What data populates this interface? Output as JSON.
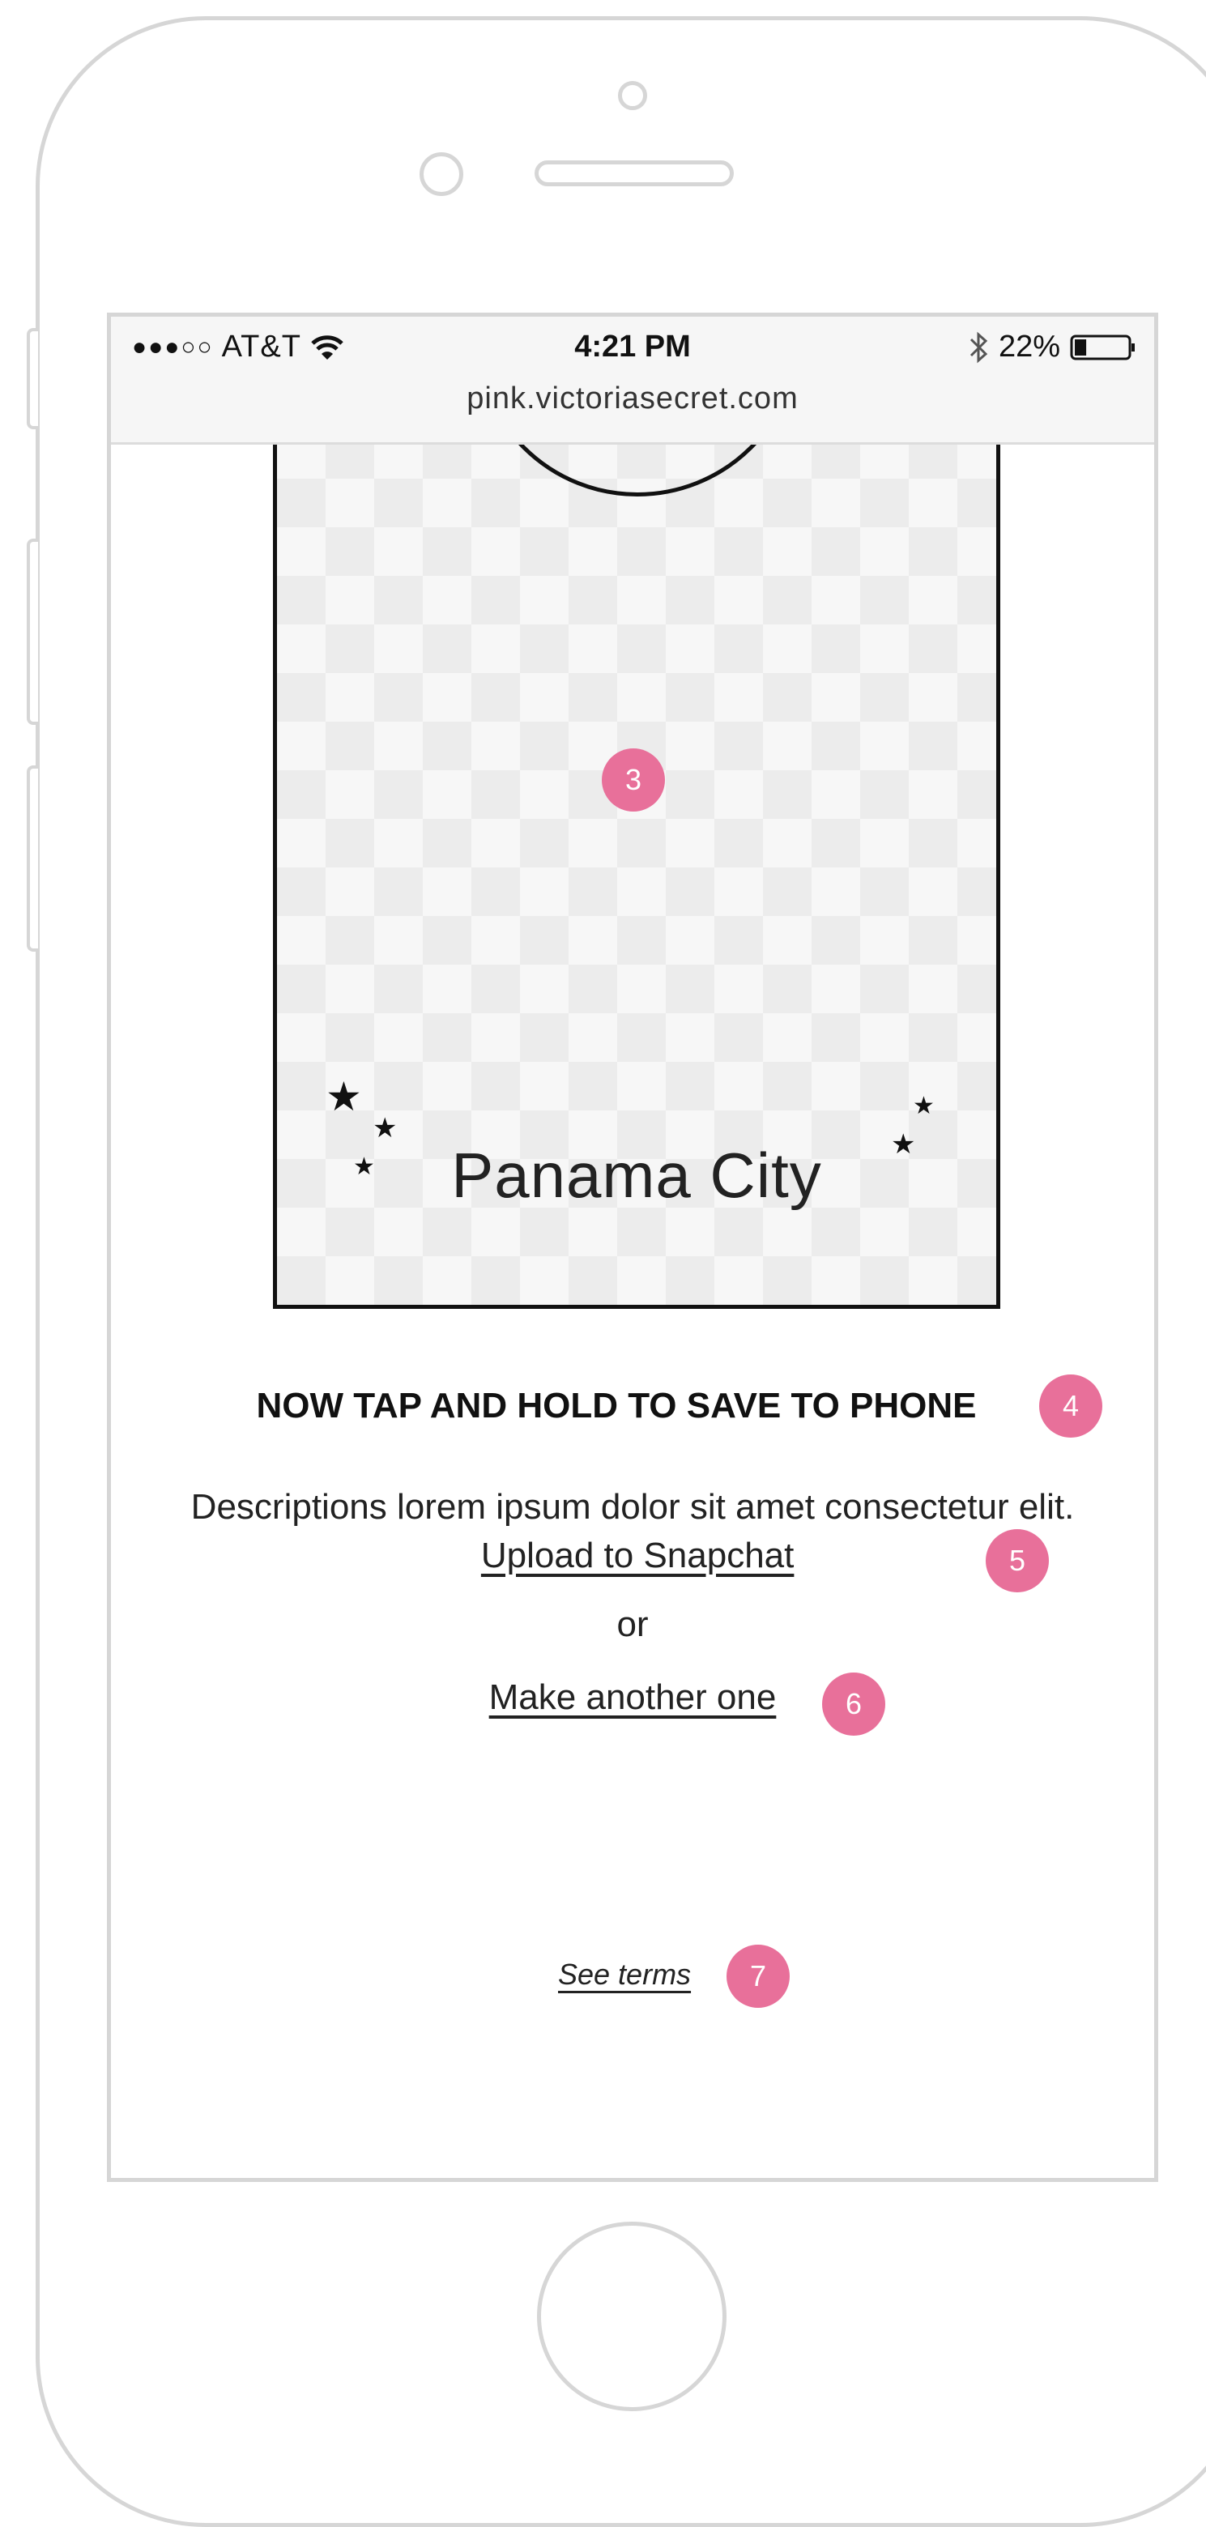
{
  "status_bar": {
    "signal": "●●●○○",
    "carrier": "AT&T",
    "time": "4:21 PM",
    "battery": "22%",
    "battery_level": 0.22,
    "url": "pink.victoriasecret.com"
  },
  "preview": {
    "city": "Panama City",
    "marker": "3"
  },
  "content": {
    "heading": "NOW TAP AND HOLD TO SAVE TO PHONE",
    "heading_marker": "4",
    "description": "Descriptions lorem ipsum dolor sit amet consectetur elit.",
    "upload_link": "Upload to Snapchat",
    "upload_marker": "5",
    "or": "or",
    "another_link": "Make another one",
    "another_marker": "6",
    "terms_link": "See terms",
    "terms_marker": "7"
  },
  "icons": [
    "wifi-icon",
    "bluetooth-icon",
    "battery-icon",
    "star-icon"
  ],
  "colors": {
    "marker": "#e8709a",
    "frame": "#d6d6d6",
    "checker": "#ececec"
  }
}
